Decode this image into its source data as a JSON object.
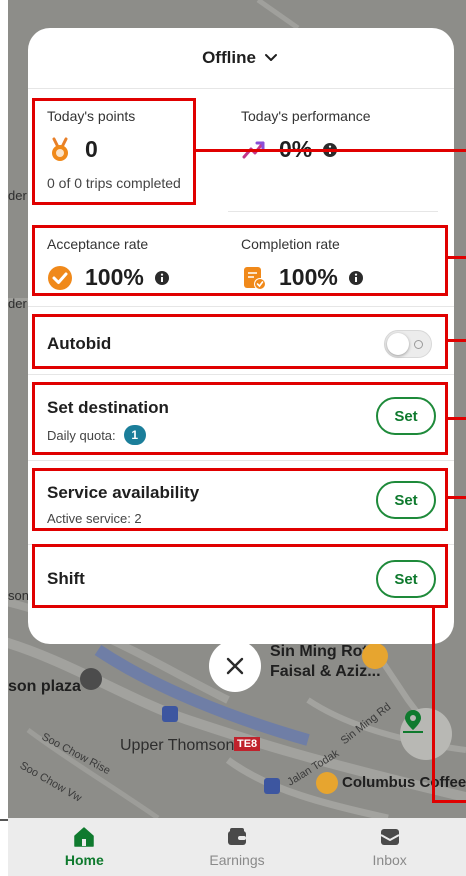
{
  "header": {
    "status_label": "Offline"
  },
  "stats": {
    "points": {
      "label": "Today's points",
      "value": "0",
      "sub": "0 of 0 trips completed"
    },
    "performance": {
      "label": "Today's performance",
      "value": "0%"
    },
    "acceptance": {
      "label": "Acceptance rate",
      "value": "100%"
    },
    "completion": {
      "label": "Completion rate",
      "value": "100%"
    }
  },
  "autobid": {
    "label": "Autobid",
    "enabled": false
  },
  "destination": {
    "title": "Set destination",
    "sub_label": "Daily quota:",
    "quota": "1",
    "button": "Set"
  },
  "service": {
    "title": "Service availability",
    "sub": "Active service: 2",
    "button": "Set"
  },
  "shift": {
    "title": "Shift",
    "button": "Set"
  },
  "map": {
    "labels": {
      "sin_ming_roti_1": "Sin Ming Roti",
      "sin_ming_roti_2": "Faisal & Aziz...",
      "son_plaza": "son plaza",
      "upper_thomson": "Upper Thomson",
      "te8": "TE8",
      "columbus": "Columbus Coffee C",
      "soo_chow_rise": "Soo Chow Rise",
      "soo_chow_vw": "Soo Chow Vw",
      "sin_ming_rd": "Sin Ming Rd",
      "jalan_todak": "Jalan Todak",
      "left_der_1": "der",
      "left_der_2": "der",
      "left_son": "son"
    }
  },
  "nav": {
    "items": [
      {
        "label": "Home",
        "active": true
      },
      {
        "label": "Earnings",
        "active": false
      },
      {
        "label": "Inbox",
        "active": false
      }
    ]
  },
  "colors": {
    "accent_green": "#0f7a2e",
    "annotation_red": "#e00000",
    "badge_blue": "#1b7e9a",
    "orange": "#f0891a"
  }
}
